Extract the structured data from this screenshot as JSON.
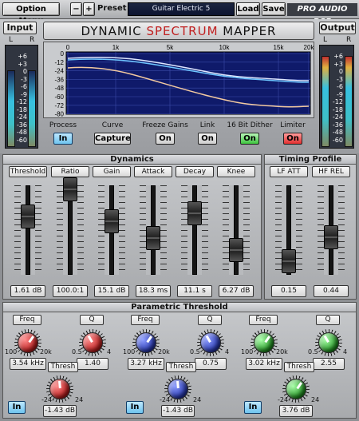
{
  "topbar": {
    "option_menu": "Option Menu",
    "minus": "−",
    "plus": "+",
    "preset_label": "Preset",
    "preset_value": "Guitar Electric 5",
    "load": "Load",
    "save": "Save",
    "brand": "PRO AUDIO DSP"
  },
  "title": {
    "pre": "DYNAMIC ",
    "accent": "SPECTRUM",
    "post": " MAPPER"
  },
  "input": {
    "label": "Input",
    "l": "L",
    "r": "R",
    "scale": [
      "+6",
      "+3",
      "0",
      "-3",
      "-6",
      "-9",
      "-12",
      "-18",
      "-24",
      "-36",
      "-48",
      "-60"
    ]
  },
  "output": {
    "label": "Output",
    "l": "L",
    "r": "R",
    "scale": [
      "+6",
      "+3",
      "0",
      "-3",
      "-6",
      "-9",
      "-12",
      "-18",
      "-24",
      "-36",
      "-48",
      "-60"
    ]
  },
  "graph": {
    "x_ticks": [
      "0",
      "1k",
      "5k",
      "10k",
      "15k",
      "20k"
    ],
    "y_ticks": [
      "0",
      "-12",
      "-24",
      "-36",
      "-48",
      "-60",
      "-72",
      "-80"
    ],
    "blue_color": "#6ec6ff",
    "white_color": "#dfe8ff",
    "peach_color": "#f2c9a0"
  },
  "toggles": [
    {
      "label": "Process",
      "value": "In"
    },
    {
      "label": "Curve",
      "value": "Capture"
    },
    {
      "label": "Freeze Gains",
      "value": "On"
    },
    {
      "label": "Link",
      "value": "On"
    },
    {
      "label": "16 Bit Dither",
      "value": "On"
    },
    {
      "label": "Limiter",
      "value": "On"
    }
  ],
  "dynamics": {
    "title": "Dynamics",
    "sliders": [
      {
        "label": "Threshold",
        "value": "1.61 dB"
      },
      {
        "label": "Ratio",
        "value": "100.0:1"
      },
      {
        "label": "Gain",
        "value": "15.1 dB"
      },
      {
        "label": "Attack",
        "value": "18.3 ms"
      },
      {
        "label": "Decay",
        "value": "11.1 s"
      },
      {
        "label": "Knee",
        "value": "6.27 dB"
      }
    ]
  },
  "timing": {
    "title": "Timing Profile",
    "sliders": [
      {
        "label": "LF ATT",
        "value": "0.15"
      },
      {
        "label": "HF REL",
        "value": "0.44"
      }
    ]
  },
  "parametric": {
    "title": "Parametric Threshold",
    "bands": [
      {
        "freq_label": "Freq",
        "q_label": "Q",
        "thresh_label": "Thresh",
        "freq_value": "3.54 kHz",
        "q_value": "1.40",
        "thresh_value": "-1.43 dB",
        "color": "red",
        "in": "In",
        "freq_min": "100",
        "freq_max": "20k",
        "q_min": "0.5",
        "q_max": "4",
        "th_min": "-24",
        "th_max": "24"
      },
      {
        "freq_label": "Freq",
        "q_label": "Q",
        "thresh_label": "Thresh",
        "freq_value": "3.27 kHz",
        "q_value": "0.75",
        "thresh_value": "-1.43 dB",
        "color": "blue",
        "in": "In",
        "freq_min": "100",
        "freq_max": "20k",
        "q_min": "0.5",
        "q_max": "4",
        "th_min": "-24",
        "th_max": "24"
      },
      {
        "freq_label": "Freq",
        "q_label": "Q",
        "thresh_label": "Thresh",
        "freq_value": "3.02 kHz",
        "q_value": "2.55",
        "thresh_value": "3.76 dB",
        "color": "green",
        "in": "In",
        "freq_min": "100",
        "freq_max": "20k",
        "q_min": "0.5",
        "q_max": "4",
        "th_min": "-24",
        "th_max": "24"
      }
    ]
  }
}
